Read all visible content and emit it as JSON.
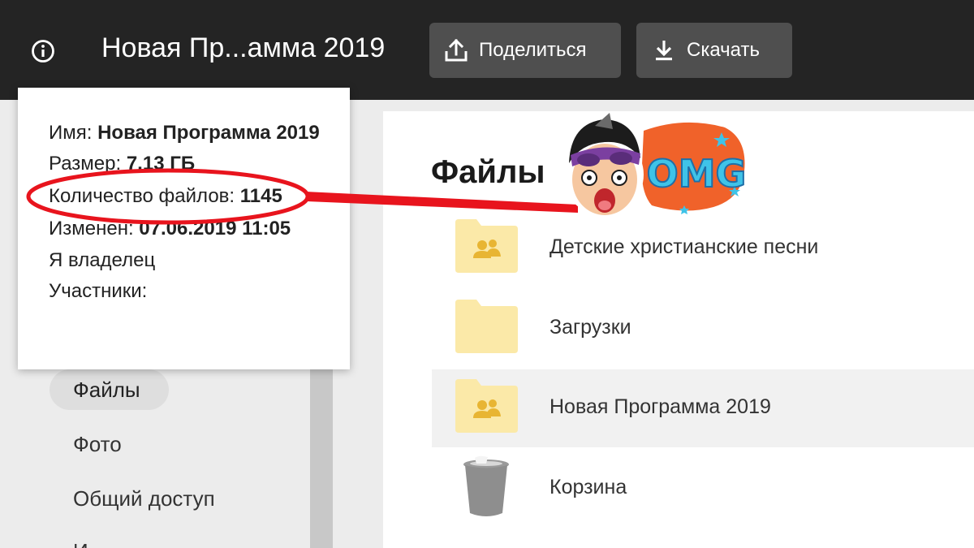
{
  "header": {
    "title": "Новая Пр...амма 2019",
    "share_label": "Поделиться",
    "download_label": "Скачать"
  },
  "info_popup": {
    "name_label": "Имя: ",
    "name_value": "Новая Программа 2019",
    "size_label": "Размер: ",
    "size_value": "7,13 ГБ",
    "count_label": "Количество файлов: ",
    "count_value": "1145",
    "modified_label": "Изменен: ",
    "modified_value": "07.06.2019 11:05",
    "owner_text": "Я владелец",
    "members_label": "Участники:"
  },
  "sidebar": {
    "items": [
      {
        "label": "Файлы",
        "active": true
      },
      {
        "label": "Фото"
      },
      {
        "label": "Общий доступ"
      },
      {
        "label": "И"
      }
    ]
  },
  "main": {
    "title": "Файлы",
    "items": [
      {
        "name": "Детские христианские песни",
        "icon": "shared-folder-icon"
      },
      {
        "name": "Загрузки",
        "icon": "folder-icon"
      },
      {
        "name": "Новая Программа 2019",
        "icon": "shared-folder-icon",
        "selected": true
      },
      {
        "name": "Корзина",
        "icon": "trash-icon"
      }
    ]
  },
  "sticker": {
    "text": "OMG"
  },
  "colors": {
    "topbar": "#242424",
    "button": "#4f4f4f",
    "folder": "#fbe9a8",
    "folder_people": "#e8b533",
    "annotation_red": "#e8141d",
    "sticker_orange": "#f0622a",
    "sticker_text": "#3fc3e8"
  }
}
